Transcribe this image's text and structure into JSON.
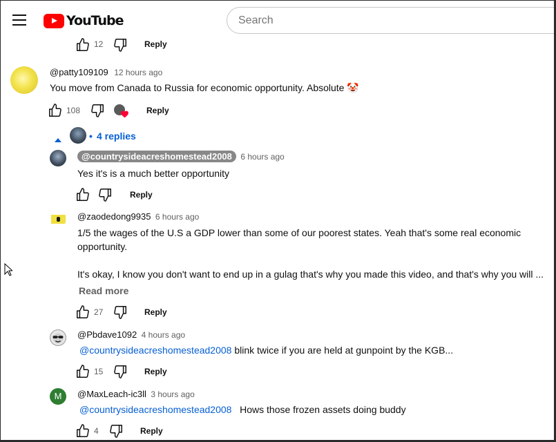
{
  "app": {
    "logo_text": "YouTube",
    "search_placeholder": "Search"
  },
  "top_actions": {
    "likes": "12",
    "reply": "Reply"
  },
  "comment": {
    "author": "@patty109109",
    "time": "12 hours ago",
    "text": "You move from Canada to Russia for economic opportunity. Absolute",
    "emoji": "🤡",
    "likes": "108",
    "reply": "Reply",
    "replies_label": "4 replies",
    "dot": "•"
  },
  "replies": [
    {
      "author": "@countrysideacreshomestead2008",
      "time": "6 hours ago",
      "text": "Yes it's is a much better opportunity",
      "likes": "",
      "reply": "Reply"
    },
    {
      "author": "@zaodedong9935",
      "time": "6 hours ago",
      "text1": "1/5 the wages of the U.S a GDP lower than some of our poorest states. Yeah that's some real economic",
      "text2": "opportunity.",
      "text3": "It's okay, I know you don't want to end up in a gulag that's why you made this video, and that's why you will ...",
      "read_more": "Read more",
      "likes": "27",
      "reply": "Reply"
    },
    {
      "author": "@Pbdave1092",
      "time": "4 hours ago",
      "mention": "@countrysideacreshomestead2008",
      "text": " blink twice if you are held at gunpoint by the KGB...",
      "likes": "15",
      "reply": "Reply"
    },
    {
      "author": "@MaxLeach-ic3ll",
      "time": "3 hours ago",
      "avatar_letter": "M",
      "mention": "@countrysideacreshomestead2008",
      "text": "   Hows those frozen assets doing buddy",
      "likes": "4",
      "reply": "Reply"
    }
  ],
  "colors": {
    "link": "#065fd4",
    "brand": "#ff0000",
    "avatar_m": "#2e7d32"
  }
}
